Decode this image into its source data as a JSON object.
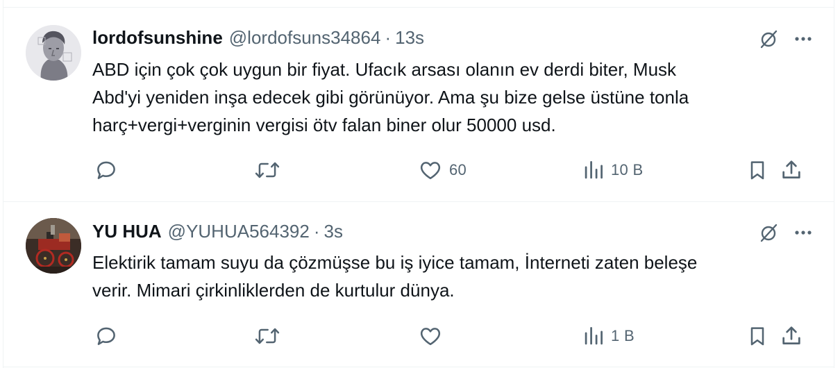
{
  "tweets": [
    {
      "display_name": "lordofsunshine",
      "handle": "@lordofsuns34864",
      "separator": "·",
      "time": "13s",
      "text": "ABD için çok çok uygun bir fiyat. Ufacık arsası olanın ev derdi biter, Musk\nAbd'yi yeniden inşa edecek gibi görünüyor. Ama şu bize gelse üstüne tonla\nharç+vergi+verginin vergisi ötv falan biner olur 50000 usd.",
      "reply_count": "",
      "retweet_count": "",
      "like_count": "60",
      "view_count": "10 B"
    },
    {
      "display_name": "YU HUA",
      "handle": "@YUHUA564392",
      "separator": "·",
      "time": "3s",
      "text": "Elektirik tamam suyu da çözmüşse bu iş iyice tamam, İnterneti zaten beleşe\nverir. Mimari çirkinliklerden de kurtulur dünya.",
      "reply_count": "",
      "retweet_count": "",
      "like_count": "",
      "view_count": "1 B"
    }
  ],
  "icons": {
    "reply": "reply-icon",
    "retweet": "retweet-icon",
    "like": "heart-icon",
    "views": "views-icon",
    "bookmark": "bookmark-icon",
    "share": "share-icon",
    "grok": "grok-icon",
    "more": "more-icon"
  },
  "colors": {
    "text": "#0f1419",
    "secondary": "#536471",
    "border": "#eff3f4"
  }
}
